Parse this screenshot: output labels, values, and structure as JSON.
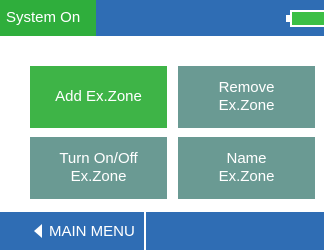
{
  "header": {
    "status": "System On",
    "battery_level": 1.0
  },
  "buttons": {
    "add": [
      "Add Ex.Zone"
    ],
    "remove": [
      "Remove",
      "Ex.Zone"
    ],
    "turn": [
      "Turn On/Off",
      "Ex.Zone"
    ],
    "name": [
      "Name",
      "Ex.Zone"
    ]
  },
  "footer": {
    "main_menu": "MAIN MENU"
  },
  "colors": {
    "header_blue": "#2f6db4",
    "status_green": "#2fae3c",
    "primary_button": "#3eb447",
    "secondary_button": "#6a9a93"
  }
}
